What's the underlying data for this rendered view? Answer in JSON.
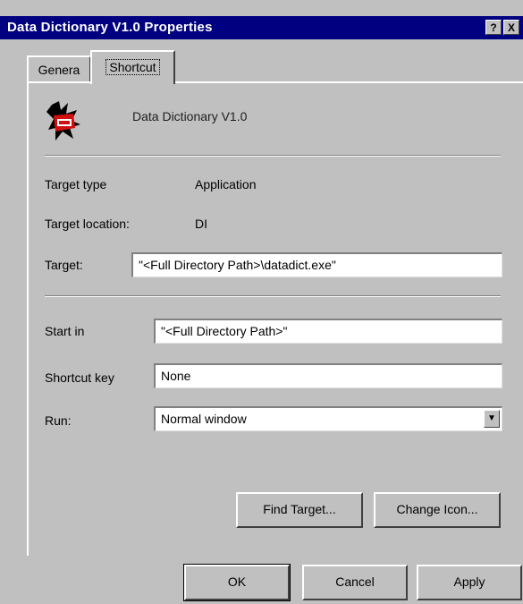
{
  "window": {
    "title": "Data Dictionary V1.0 Properties",
    "help_button": "?",
    "close_button": "X"
  },
  "tabs": {
    "general": "Genera",
    "shortcut": "Shortcut"
  },
  "shortcut": {
    "app_name": "Data Dictionary V1.0",
    "target_type_label": "Target type",
    "target_type_value": "Application",
    "target_location_label": "Target location:",
    "target_location_value": "DI",
    "target_label": "Target:",
    "target_value": "\"<Full Directory Path>\\datadict.exe\"",
    "start_in_label": "Start in",
    "start_in_value": "\"<Full Directory Path>\"",
    "shortcut_key_label": "Shortcut key",
    "shortcut_key_value": "None",
    "run_label": "Run:",
    "run_value": "Normal window",
    "find_target_button": "Find Target...",
    "change_icon_button": "Change Icon..."
  },
  "footer": {
    "ok": "OK",
    "cancel": "Cancel",
    "apply": "Apply"
  }
}
